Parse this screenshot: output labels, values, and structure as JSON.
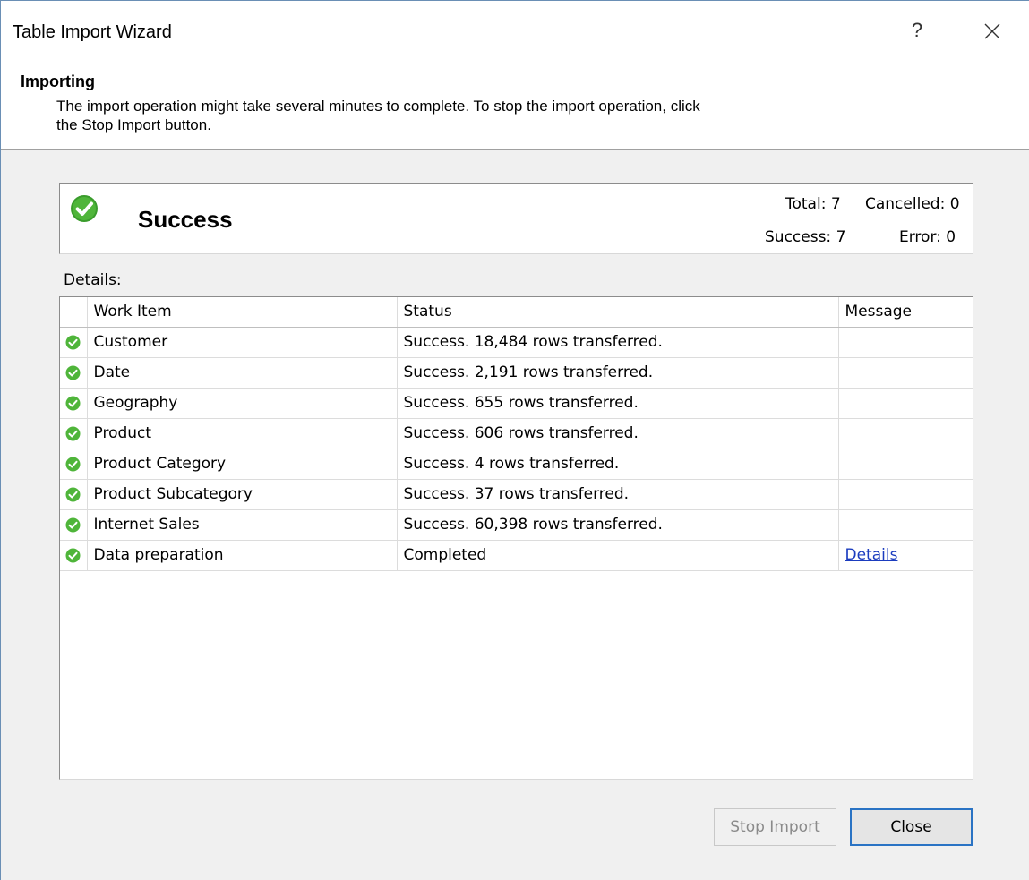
{
  "window": {
    "title": "Table Import Wizard",
    "help_glyph": "?"
  },
  "header": {
    "title": "Importing",
    "description": "The import operation might take several minutes to complete. To stop the import operation, click the Stop Import button."
  },
  "summary": {
    "status": "Success",
    "status_icon": "success-check-icon",
    "total_label": "Total: 7",
    "cancelled_label": "Cancelled: 0",
    "success_label": "Success: 7",
    "error_label": "Error: 0"
  },
  "details": {
    "label": "Details:",
    "columns": [
      "Work Item",
      "Status",
      "Message"
    ],
    "rows": [
      {
        "item": "Customer",
        "status": "Success. 18,484 rows transferred.",
        "message": ""
      },
      {
        "item": "Date",
        "status": "Success. 2,191 rows transferred.",
        "message": ""
      },
      {
        "item": "Geography",
        "status": "Success. 655 rows transferred.",
        "message": ""
      },
      {
        "item": "Product",
        "status": "Success. 606 rows transferred.",
        "message": ""
      },
      {
        "item": "Product Category",
        "status": "Success. 4 rows transferred.",
        "message": ""
      },
      {
        "item": "Product Subcategory",
        "status": "Success. 37 rows transferred.",
        "message": ""
      },
      {
        "item": "Internet Sales",
        "status": "Success. 60,398 rows transferred.",
        "message": ""
      },
      {
        "item": "Data preparation",
        "status": "Completed",
        "message": "Details"
      }
    ]
  },
  "buttons": {
    "stop_import_accel": "S",
    "stop_import_rest": "top Import",
    "close": "Close"
  },
  "colors": {
    "success_green": "#4fb53a",
    "link_blue": "#1b3cbf",
    "focus_blue": "#2a73c4"
  }
}
